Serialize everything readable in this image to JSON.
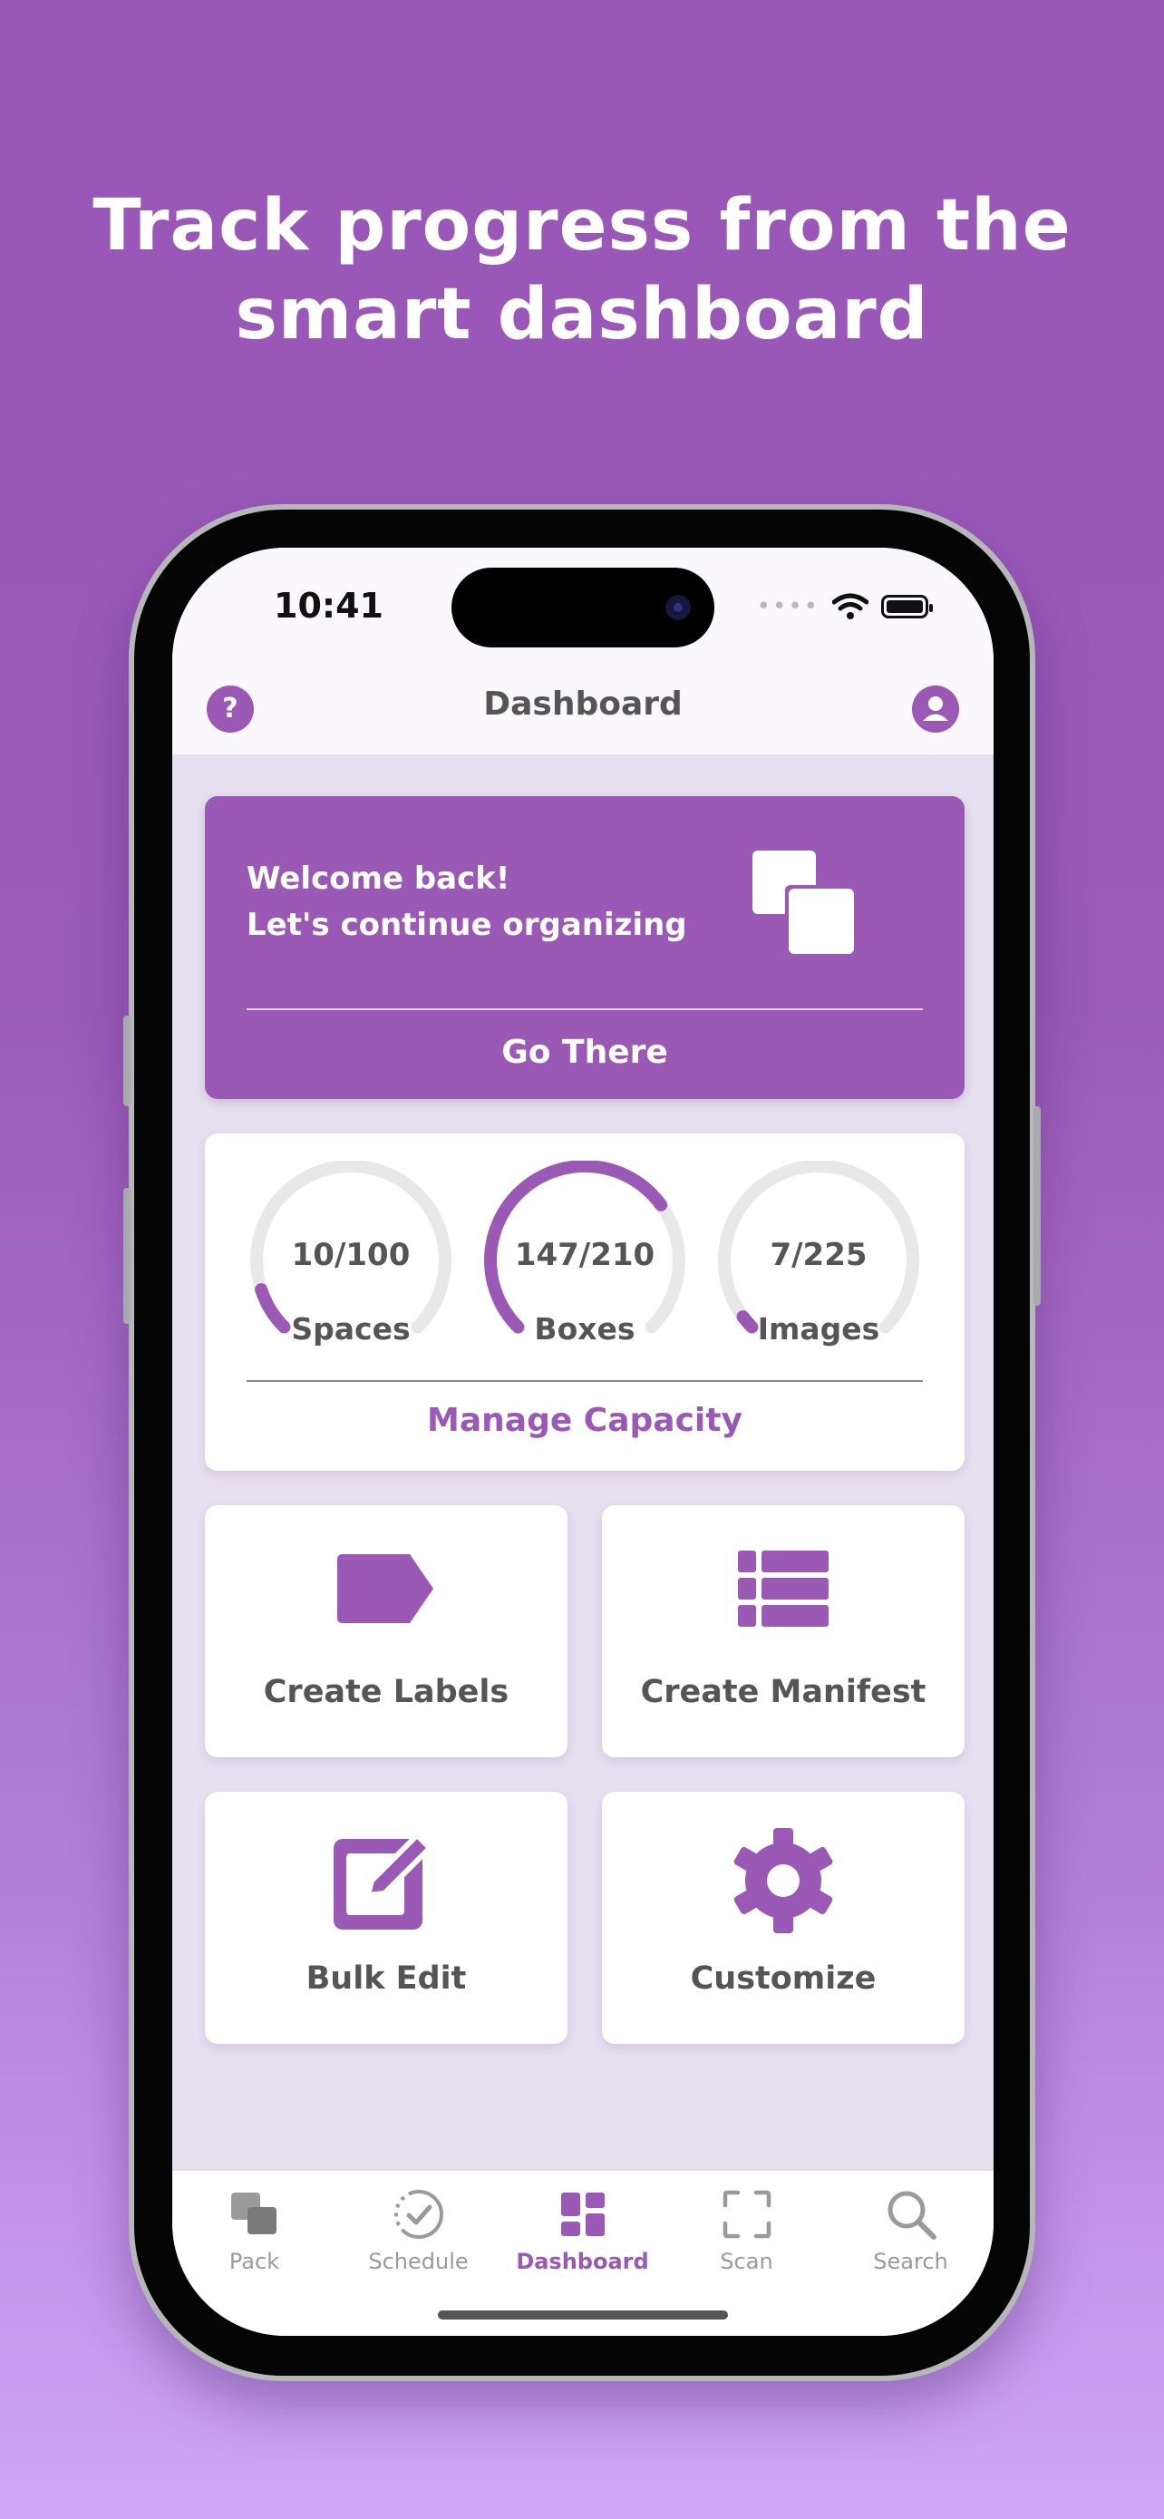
{
  "headline": {
    "line1": "Track progress from the",
    "line2": "smart dashboard"
  },
  "status_bar": {
    "time": "10:41",
    "signal_icon": "signal-dots-icon",
    "wifi_icon": "wifi-icon",
    "battery_icon": "battery-icon"
  },
  "nav": {
    "title": "Dashboard",
    "help_icon": "question-icon",
    "help_glyph": "?",
    "profile_icon": "user-icon"
  },
  "welcome": {
    "line1": "Welcome back!",
    "line2": "Let's continue organizing",
    "action": "Go There",
    "icon": "stacked-squares-icon"
  },
  "capacity": {
    "gauges": [
      {
        "value": "10/100",
        "label": "Spaces",
        "fraction": 0.1
      },
      {
        "value": "147/210",
        "label": "Boxes",
        "fraction": 0.7
      },
      {
        "value": "7/225",
        "label": "Images",
        "fraction": 0.031
      }
    ],
    "action": "Manage Capacity"
  },
  "tiles": [
    {
      "label": "Create Labels",
      "icon": "tag-icon"
    },
    {
      "label": "Create Manifest",
      "icon": "list-icon"
    },
    {
      "label": "Bulk Edit",
      "icon": "edit-icon"
    },
    {
      "label": "Customize",
      "icon": "gear-icon"
    }
  ],
  "tabs": [
    {
      "label": "Pack",
      "icon": "pack-icon",
      "active": false
    },
    {
      "label": "Schedule",
      "icon": "schedule-check-icon",
      "active": false
    },
    {
      "label": "Dashboard",
      "icon": "dashboard-grid-icon",
      "active": true
    },
    {
      "label": "Scan",
      "icon": "scan-frame-icon",
      "active": false
    },
    {
      "label": "Search",
      "icon": "search-icon",
      "active": false
    }
  ],
  "colors": {
    "accent": "#9b59b6",
    "background_top": "#9957b8",
    "background_bottom": "#cfa6f7",
    "gauge_track": "#e8e8e8"
  }
}
